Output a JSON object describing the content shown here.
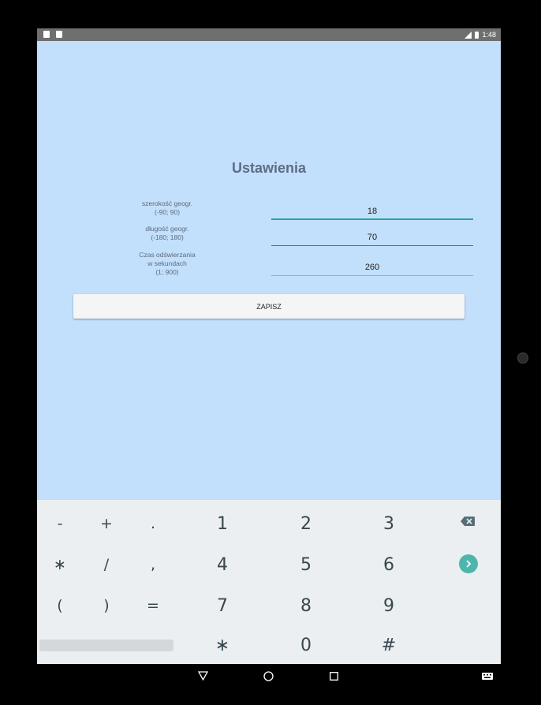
{
  "status_bar": {
    "time": "1:48"
  },
  "screen": {
    "title": "Ustawienia",
    "fields": [
      {
        "label_lines": [
          "szerokość geogr.",
          "(-90; 90)"
        ],
        "value": "18"
      },
      {
        "label_lines": [
          "długość geogr.",
          "(-180; 180)"
        ],
        "value": "70"
      },
      {
        "label_lines": [
          "Czas odświerzania",
          "w sekundach",
          "(1; 900)"
        ],
        "value": "260"
      }
    ],
    "save_label": "ZAPISZ"
  },
  "keyboard": {
    "rows": [
      [
        "-",
        "+",
        ".",
        "1",
        "2",
        "3"
      ],
      [
        "∗",
        "/",
        ",",
        "4",
        "5",
        "6"
      ],
      [
        "(",
        ")",
        "=",
        "7",
        "8",
        "9"
      ],
      [
        "∗",
        "0",
        "#"
      ]
    ],
    "special_icons": [
      "backspace-icon",
      "next-arrow-icon"
    ]
  },
  "nav_bar": {
    "icons": [
      "back-icon",
      "home-icon",
      "recents-icon",
      "keyboard-switch-icon"
    ]
  },
  "colors": {
    "screen_bg": "#c2dffc",
    "keyboard_bg": "#eceff1",
    "accent": "#4db6ac",
    "title": "#5d6d84"
  }
}
